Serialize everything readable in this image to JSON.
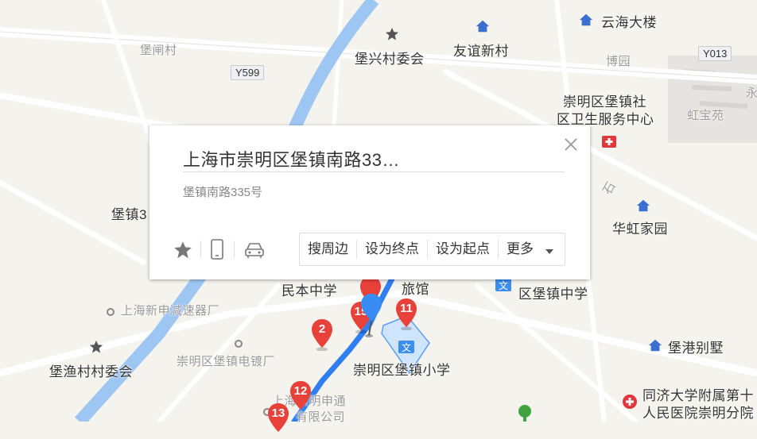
{
  "map": {
    "labels": {
      "baozha_village": "堡闸村",
      "y599": "Y599",
      "baoxing_committee": "堡兴村委会",
      "youyi_xincun": "友谊新村",
      "yunhai_tower": "云海大楼",
      "boyuan": "博园",
      "y013": "Y013",
      "yong": "永",
      "clinic": "崇明区堡镇社\n区卫生服务中心",
      "clinic_line1": "崇明区堡镇社",
      "clinic_line2": "区卫生服务中心",
      "hongbaoyuan": "虹宝苑",
      "baozhen_left": "堡镇3",
      "huahong": "华虹家园",
      "minben": "民本中学",
      "hotel": "旅馆",
      "baozhen_middle_school": "区堡镇中学",
      "shanghai_reducer": "上海新申减速器厂",
      "electroplate": "崇明区堡镇电镀厂",
      "baoyu_committee": "堡渔村村委会",
      "primary_school": "崇明区堡镇小学",
      "baogang_villa": "堡港别墅",
      "hospital_line1": "同济大学附属第十",
      "hospital_line2": "人民医院崇明分院",
      "company_line1": "上海崇明申通",
      "company_line2": "有限公司",
      "road_frag": "石"
    },
    "markers": [
      "2",
      "11",
      "12",
      "13",
      "15"
    ]
  },
  "popup": {
    "title": "上海市崇明区堡镇南路33…",
    "address": "堡镇南路335号",
    "actions": {
      "nearby": "搜周边",
      "set_end": "设为终点",
      "set_start": "设为起点",
      "more": "更多"
    }
  },
  "colors": {
    "water": "#9ec6f3",
    "route": "#3385ff",
    "marker": "#e7413a",
    "land": "#f5f3ee"
  }
}
